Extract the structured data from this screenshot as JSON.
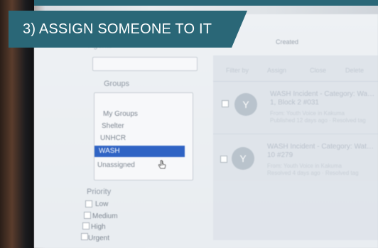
{
  "banner": {
    "text": "3) ASSIGN SOMEONE TO IT"
  },
  "filters": {
    "agents_label": "Agents",
    "groups_label": "Groups",
    "groups": [
      "My Groups",
      "Shelter",
      "UNHCR",
      "WASH",
      "Unassigned"
    ],
    "selected_group": "WASH",
    "priority_label": "Priority",
    "priorities": [
      "Low",
      "Medium",
      "High",
      "Urgent"
    ]
  },
  "list": {
    "sort_label": "Created",
    "header_tabs": [
      "Filter by",
      "Assign",
      "Close",
      "Delete"
    ],
    "items": [
      {
        "avatar": "Y",
        "title": "WASH Incident - Category: Wa… 1, Block 2 #031",
        "meta1": "From: Youth Voice in Kakuma",
        "meta2": "Published 12 days ago · Resolved tag"
      },
      {
        "avatar": "Y",
        "title": "WASH Incident - Category: Wat… 10 #279",
        "meta1": "From: Youth Voice in Kakuma",
        "meta2": "Resolved 4 days ago · Resolved tag"
      }
    ]
  },
  "colors": {
    "banner": "#2a6777",
    "selection": "#2f63c4"
  }
}
